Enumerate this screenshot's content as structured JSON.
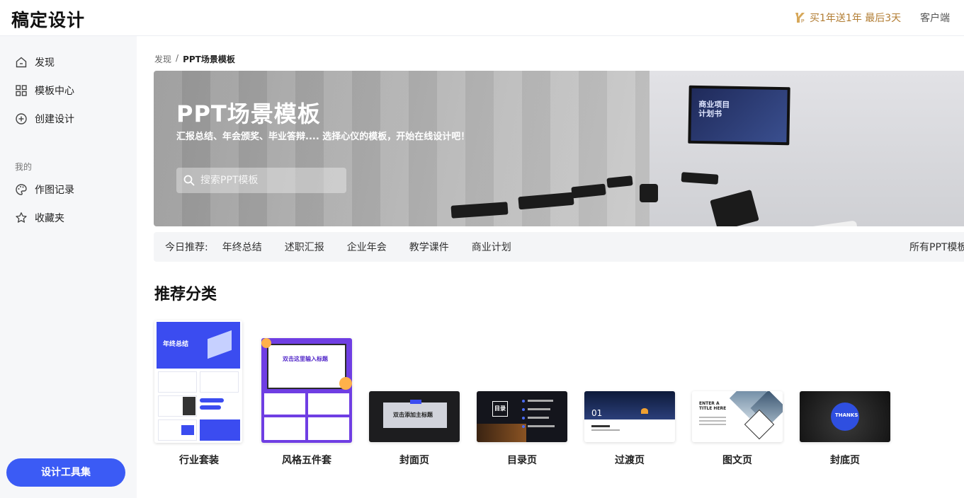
{
  "header": {
    "logo": "稿定设计",
    "promo": "买1年送1年 最后3天",
    "client": "客户端"
  },
  "sidebar": {
    "items": [
      {
        "label": "发现",
        "icon": "home-icon"
      },
      {
        "label": "模板中心",
        "icon": "grid-icon"
      },
      {
        "label": "创建设计",
        "icon": "plus-circle-icon"
      }
    ],
    "section": "我的",
    "my_items": [
      {
        "label": "作图记录",
        "icon": "palette-icon"
      },
      {
        "label": "收藏夹",
        "icon": "star-icon"
      }
    ],
    "tool_button": "设计工具集"
  },
  "breadcrumb": {
    "root": "发现",
    "sep": "/",
    "current": "PPT场景模板"
  },
  "banner": {
    "title": "PPT场景模板",
    "subtitle": "汇报总结、年会颁奖、毕业答辩.... 选择心仪的模板，开始在线设计吧！",
    "search_placeholder": "搜索PPT模板",
    "tv_text_1": "商业项目",
    "tv_text_2": "计划书"
  },
  "recommend": {
    "label": "今日推荐:",
    "tags": [
      "年终总结",
      "述职汇报",
      "企业年会",
      "教学课件",
      "商业计划"
    ],
    "all": "所有PPT模板"
  },
  "categories": {
    "title": "推荐分类",
    "items": [
      {
        "label": "行业套装",
        "thumb_text": "年终总结"
      },
      {
        "label": "风格五件套",
        "thumb_text": "双击这里输入标题"
      },
      {
        "label": "封面页",
        "thumb_text": "双击添加主标题"
      },
      {
        "label": "目录页",
        "thumb_text": "目录"
      },
      {
        "label": "过渡页",
        "thumb_text": "01"
      },
      {
        "label": "图文页",
        "thumb_text": "ENTER A TITLE HERE"
      },
      {
        "label": "封底页",
        "thumb_text": "THANKS"
      }
    ]
  },
  "colors": {
    "accent": "#3b5bf5",
    "promo": "#b27d33"
  }
}
